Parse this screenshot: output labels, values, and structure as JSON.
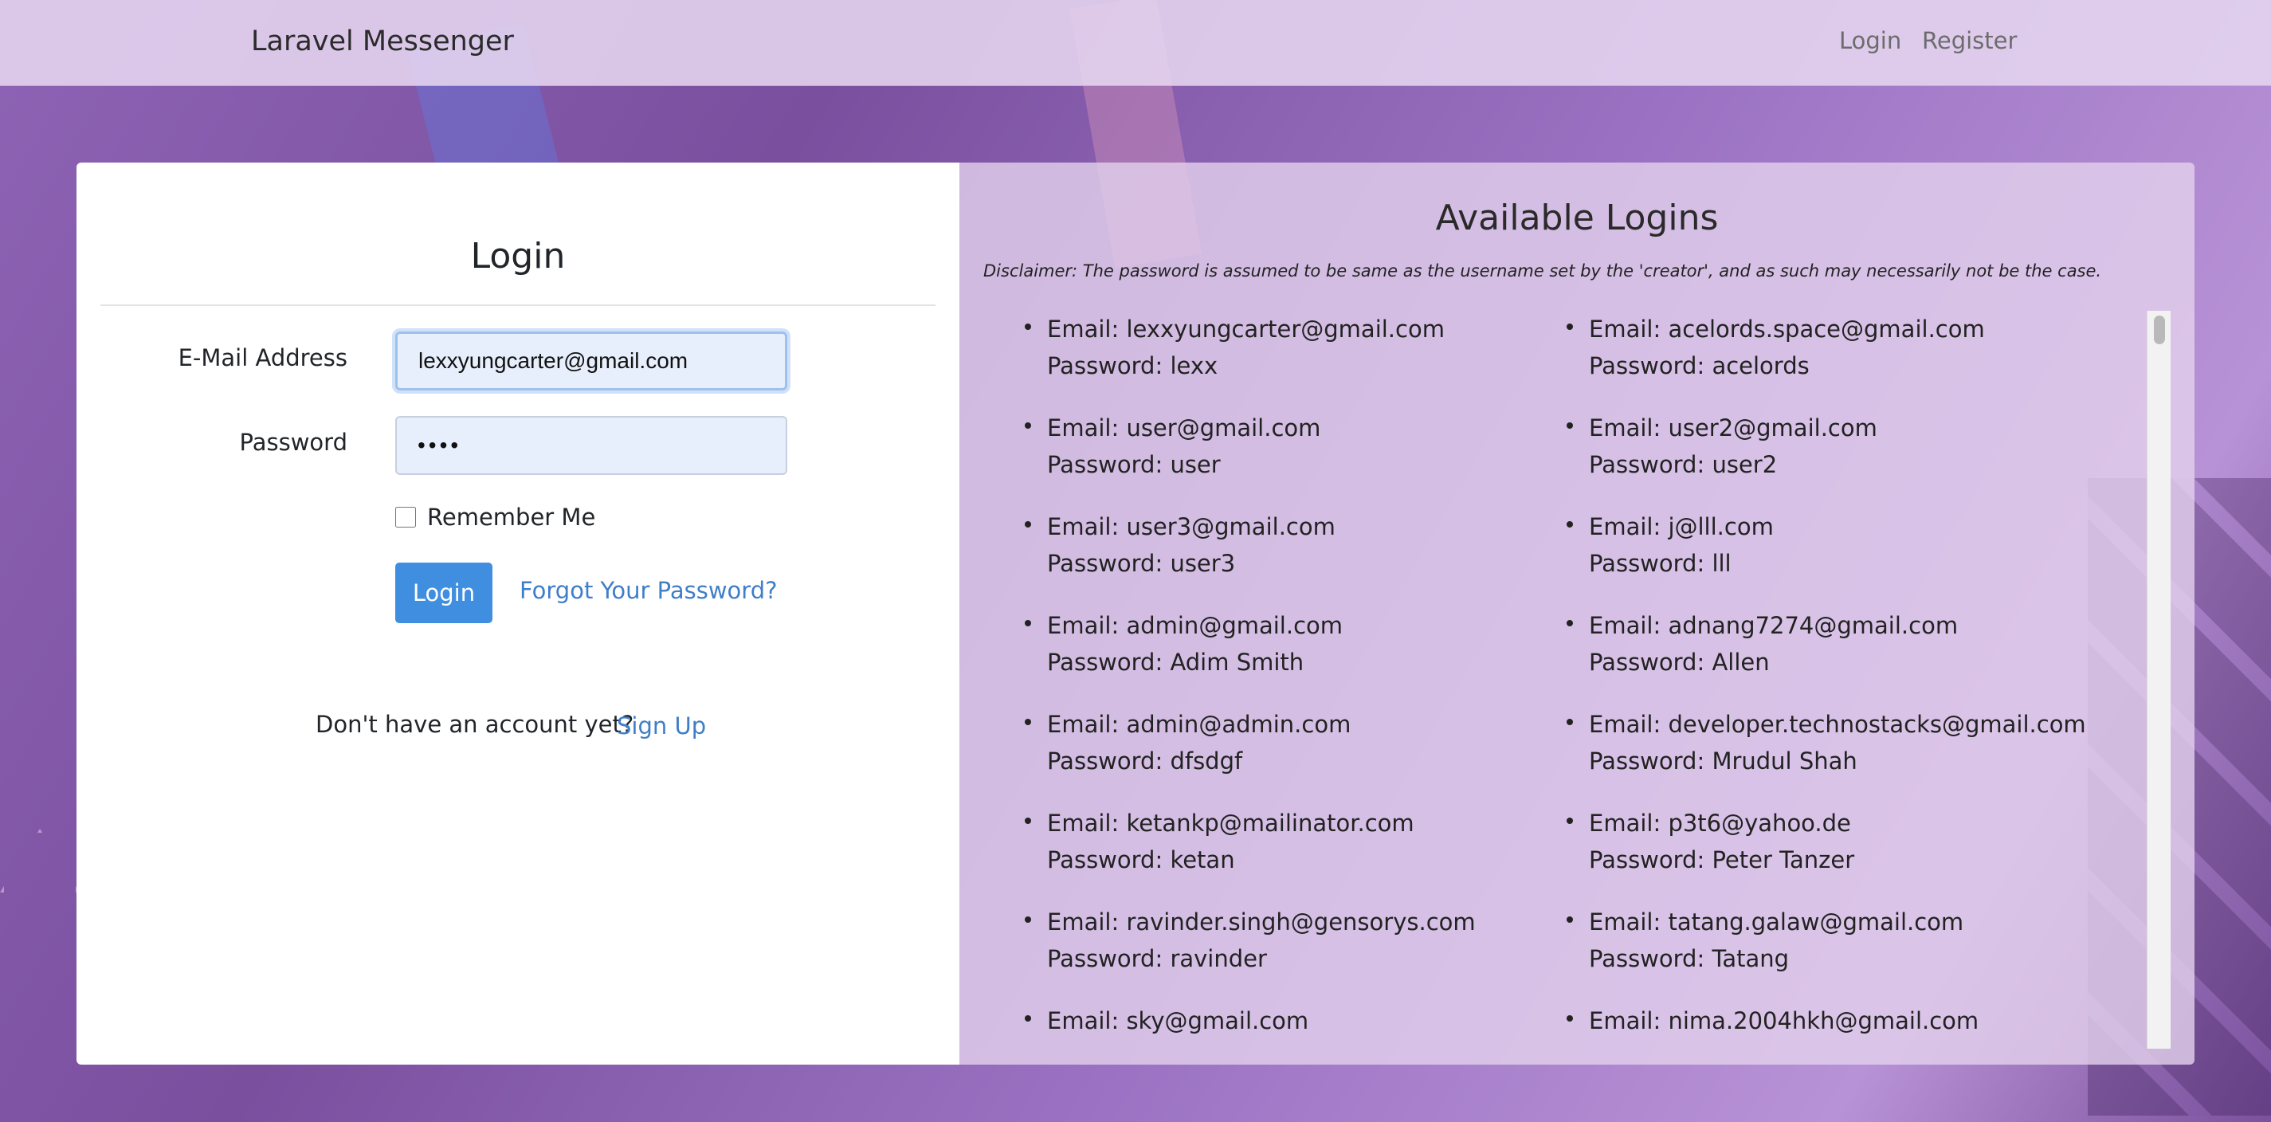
{
  "navbar": {
    "brand": "Laravel Messenger",
    "login_label": "Login",
    "register_label": "Register"
  },
  "login_form": {
    "title": "Login",
    "email_label": "E-Mail Address",
    "email_value": "lexxyungcarter@gmail.com",
    "password_label": "Password",
    "password_value": "lexx",
    "remember_label": "Remember Me",
    "submit_label": "Login",
    "forgot_label": "Forgot Your Password?",
    "no_account_text": "Don't have an account yet?",
    "signup_label": "Sign Up"
  },
  "available_logins": {
    "title": "Available Logins",
    "disclaimer": "Disclaimer: The password is assumed to be same as the username set by the 'creator', and as such may necessarily not be the case.",
    "left": [
      {
        "email": "Email: lexxyungcarter@gmail.com",
        "password": "Password: lexx"
      },
      {
        "email": "Email: user@gmail.com",
        "password": "Password: user"
      },
      {
        "email": "Email: user3@gmail.com",
        "password": "Password: user3"
      },
      {
        "email": "Email: admin@gmail.com",
        "password": "Password: Adim Smith"
      },
      {
        "email": "Email: admin@admin.com",
        "password": "Password: dfsdgf"
      },
      {
        "email": "Email: ketankp@mailinator.com",
        "password": "Password: ketan"
      },
      {
        "email": "Email: ravinder.singh@gensorys.com",
        "password": "Password: ravinder"
      },
      {
        "email": "Email: sky@gmail.com",
        "password": ""
      }
    ],
    "right": [
      {
        "email": "Email: acelords.space@gmail.com",
        "password": "Password: acelords"
      },
      {
        "email": "Email: user2@gmail.com",
        "password": "Password: user2"
      },
      {
        "email": "Email: j@lll.com",
        "password": "Password: lll"
      },
      {
        "email": "Email: adnang7274@gmail.com",
        "password": "Password: Allen"
      },
      {
        "email": "Email: developer.technostacks@gmail.com",
        "password": "Password: Mrudul Shah"
      },
      {
        "email": "Email: p3t6@yahoo.de",
        "password": "Password: Peter Tanzer"
      },
      {
        "email": "Email: tatang.galaw@gmail.com",
        "password": "Password: Tatang"
      },
      {
        "email": "Email: nima.2004hkh@gmail.com",
        "password": ""
      }
    ]
  }
}
